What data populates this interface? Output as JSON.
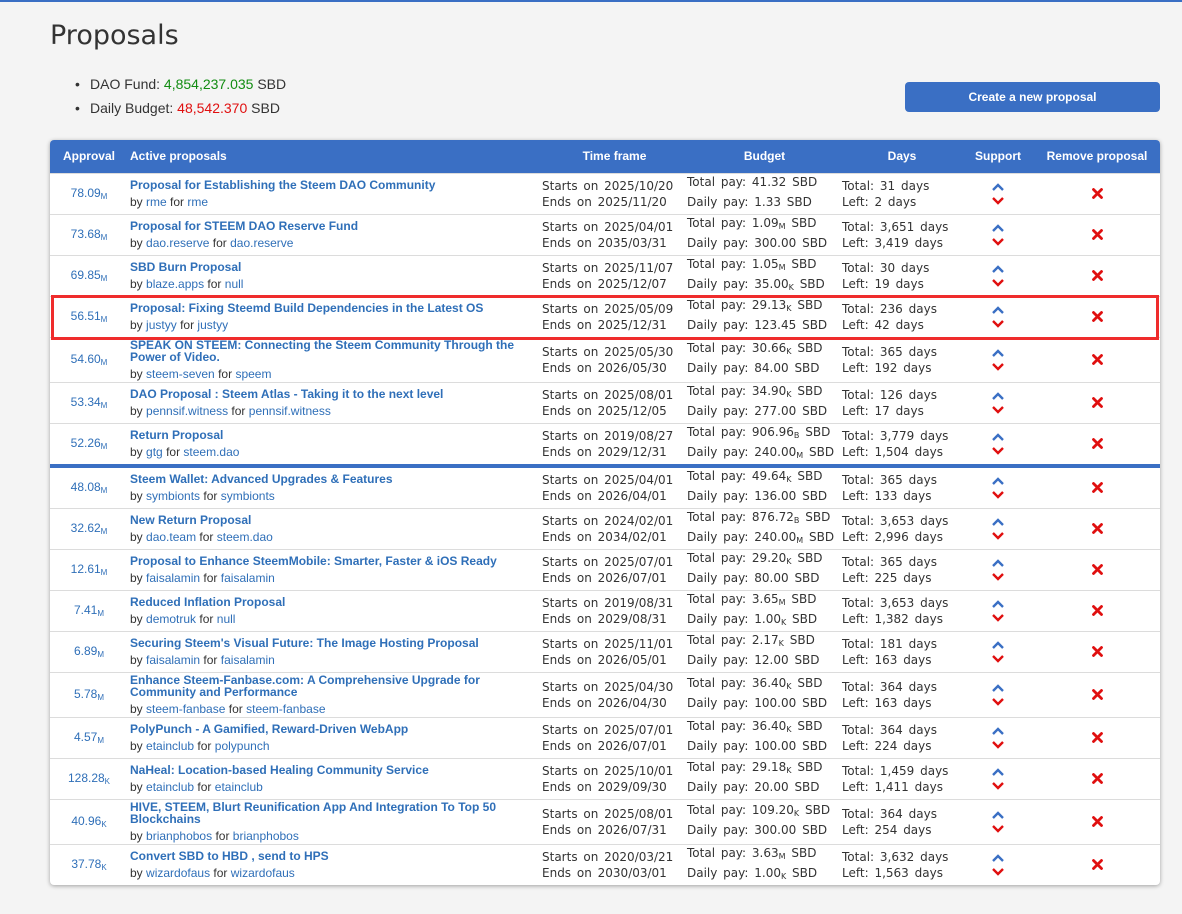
{
  "page": {
    "title": "Proposals"
  },
  "summary": {
    "dao_fund_label": "DAO Fund:",
    "dao_fund_value": "4,854,237.035",
    "daily_budget_label": "Daily Budget:",
    "daily_budget_value": "48,542.370",
    "currency": "SBD"
  },
  "create_button": "Create a new proposal",
  "headers": {
    "approval": "Approval",
    "title": "Active proposals",
    "time": "Time frame",
    "budget": "Budget",
    "days": "Days",
    "support": "Support",
    "remove": "Remove proposal"
  },
  "labels": {
    "by": "by",
    "for": "for",
    "starts": "Starts on",
    "ends": "Ends on",
    "total_pay": "Total pay:",
    "daily_pay": "Daily pay:",
    "total": "Total:",
    "left": "Left:",
    "days": "days",
    "currency": "SBD"
  },
  "colors": {
    "accent": "#3a6fc4",
    "link": "#2f6fb8",
    "green": "#128c12",
    "red": "#e00f0f",
    "highlight": "#ef2c2c"
  },
  "icons": {
    "upvote": "chevron-up-icon",
    "downvote": "chevron-down-icon",
    "remove": "cross-icon"
  },
  "highlighted_row": 3,
  "funded_divider_after": 6,
  "proposals": [
    {
      "approval": "78.09",
      "approval_unit": "M",
      "title": "Proposal for Establishing the Steem DAO Community",
      "creator": "rme",
      "receiver": "rme",
      "start": "2025/10/20",
      "end": "2025/11/20",
      "total_pay": "41.32",
      "total_pay_unit": "",
      "daily_pay": "1.33",
      "daily_pay_unit": "",
      "total_days": "31",
      "left_days": "2"
    },
    {
      "approval": "73.68",
      "approval_unit": "M",
      "title": "Proposal for STEEM DAO Reserve Fund",
      "creator": "dao.reserve",
      "receiver": "dao.reserve",
      "start": "2025/04/01",
      "end": "2035/03/31",
      "total_pay": "1.09",
      "total_pay_unit": "M",
      "daily_pay": "300.00",
      "daily_pay_unit": "",
      "total_days": "3,651",
      "left_days": "3,419"
    },
    {
      "approval": "69.85",
      "approval_unit": "M",
      "title": "SBD Burn Proposal",
      "creator": "blaze.apps",
      "receiver": "null",
      "start": "2025/11/07",
      "end": "2025/12/07",
      "total_pay": "1.05",
      "total_pay_unit": "M",
      "daily_pay": "35.00",
      "daily_pay_unit": "K",
      "total_days": "30",
      "left_days": "19"
    },
    {
      "approval": "56.51",
      "approval_unit": "M",
      "title": "Proposal: Fixing Steemd Build Dependencies in the Latest OS",
      "creator": "justyy",
      "receiver": "justyy",
      "start": "2025/05/09",
      "end": "2025/12/31",
      "total_pay": "29.13",
      "total_pay_unit": "K",
      "daily_pay": "123.45",
      "daily_pay_unit": "",
      "total_days": "236",
      "left_days": "42"
    },
    {
      "approval": "54.60",
      "approval_unit": "M",
      "title": "SPEAK ON STEEM: Connecting the Steem Community Through the Power of Video.",
      "creator": "steem-seven",
      "receiver": "speem",
      "start": "2025/05/30",
      "end": "2026/05/30",
      "total_pay": "30.66",
      "total_pay_unit": "K",
      "daily_pay": "84.00",
      "daily_pay_unit": "",
      "total_days": "365",
      "left_days": "192"
    },
    {
      "approval": "53.34",
      "approval_unit": "M",
      "title": "DAO Proposal : Steem Atlas - Taking it to the next level",
      "creator": "pennsif.witness",
      "receiver": "pennsif.witness",
      "start": "2025/08/01",
      "end": "2025/12/05",
      "total_pay": "34.90",
      "total_pay_unit": "K",
      "daily_pay": "277.00",
      "daily_pay_unit": "",
      "total_days": "126",
      "left_days": "17"
    },
    {
      "approval": "52.26",
      "approval_unit": "M",
      "title": "Return Proposal",
      "creator": "gtg",
      "receiver": "steem.dao",
      "start": "2019/08/27",
      "end": "2029/12/31",
      "total_pay": "906.96",
      "total_pay_unit": "B",
      "daily_pay": "240.00",
      "daily_pay_unit": "M",
      "total_days": "3,779",
      "left_days": "1,504"
    },
    {
      "approval": "48.08",
      "approval_unit": "M",
      "title": "Steem Wallet: Advanced Upgrades & Features",
      "creator": "symbionts",
      "receiver": "symbionts",
      "start": "2025/04/01",
      "end": "2026/04/01",
      "total_pay": "49.64",
      "total_pay_unit": "K",
      "daily_pay": "136.00",
      "daily_pay_unit": "",
      "total_days": "365",
      "left_days": "133"
    },
    {
      "approval": "32.62",
      "approval_unit": "M",
      "title": "New Return Proposal",
      "creator": "dao.team",
      "receiver": "steem.dao",
      "start": "2024/02/01",
      "end": "2034/02/01",
      "total_pay": "876.72",
      "total_pay_unit": "B",
      "daily_pay": "240.00",
      "daily_pay_unit": "M",
      "total_days": "3,653",
      "left_days": "2,996"
    },
    {
      "approval": "12.61",
      "approval_unit": "M",
      "title": "Proposal to Enhance SteemMobile: Smarter, Faster & iOS Ready",
      "creator": "faisalamin",
      "receiver": "faisalamin",
      "start": "2025/07/01",
      "end": "2026/07/01",
      "total_pay": "29.20",
      "total_pay_unit": "K",
      "daily_pay": "80.00",
      "daily_pay_unit": "",
      "total_days": "365",
      "left_days": "225"
    },
    {
      "approval": "7.41",
      "approval_unit": "M",
      "title": "Reduced Inflation Proposal",
      "creator": "demotruk",
      "receiver": "null",
      "start": "2019/08/31",
      "end": "2029/08/31",
      "total_pay": "3.65",
      "total_pay_unit": "M",
      "daily_pay": "1.00",
      "daily_pay_unit": "K",
      "total_days": "3,653",
      "left_days": "1,382"
    },
    {
      "approval": "6.89",
      "approval_unit": "M",
      "title": "Securing Steem's Visual Future: The Image Hosting Proposal",
      "creator": "faisalamin",
      "receiver": "faisalamin",
      "start": "2025/11/01",
      "end": "2026/05/01",
      "total_pay": "2.17",
      "total_pay_unit": "K",
      "daily_pay": "12.00",
      "daily_pay_unit": "",
      "total_days": "181",
      "left_days": "163"
    },
    {
      "approval": "5.78",
      "approval_unit": "M",
      "title": "Enhance Steem-Fanbase.com: A Comprehensive Upgrade for Community and Performance",
      "creator": "steem-fanbase",
      "receiver": "steem-fanbase",
      "start": "2025/04/30",
      "end": "2026/04/30",
      "total_pay": "36.40",
      "total_pay_unit": "K",
      "daily_pay": "100.00",
      "daily_pay_unit": "",
      "total_days": "364",
      "left_days": "163"
    },
    {
      "approval": "4.57",
      "approval_unit": "M",
      "title": "PolyPunch - A Gamified, Reward-Driven WebApp",
      "creator": "etainclub",
      "receiver": "polypunch",
      "start": "2025/07/01",
      "end": "2026/07/01",
      "total_pay": "36.40",
      "total_pay_unit": "K",
      "daily_pay": "100.00",
      "daily_pay_unit": "",
      "total_days": "364",
      "left_days": "224"
    },
    {
      "approval": "128.28",
      "approval_unit": "K",
      "title": "NaHeal: Location-based Healing Community Service",
      "creator": "etainclub",
      "receiver": "etainclub",
      "start": "2025/10/01",
      "end": "2029/09/30",
      "total_pay": "29.18",
      "total_pay_unit": "K",
      "daily_pay": "20.00",
      "daily_pay_unit": "",
      "total_days": "1,459",
      "left_days": "1,411"
    },
    {
      "approval": "40.96",
      "approval_unit": "K",
      "title": "HIVE, STEEM, Blurt Reunification App And Integration To Top 50 Blockchains",
      "creator": "brianphobos",
      "receiver": "brianphobos",
      "start": "2025/08/01",
      "end": "2026/07/31",
      "total_pay": "109.20",
      "total_pay_unit": "K",
      "daily_pay": "300.00",
      "daily_pay_unit": "",
      "total_days": "364",
      "left_days": "254"
    },
    {
      "approval": "37.78",
      "approval_unit": "K",
      "title": "Convert SBD to HBD , send to HPS",
      "creator": "wizardofaus",
      "receiver": "wizardofaus",
      "start": "2020/03/21",
      "end": "2030/03/01",
      "total_pay": "3.63",
      "total_pay_unit": "M",
      "daily_pay": "1.00",
      "daily_pay_unit": "K",
      "total_days": "3,632",
      "left_days": "1,563"
    }
  ]
}
